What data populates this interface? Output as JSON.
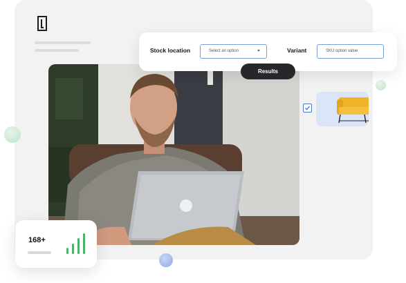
{
  "logo": {
    "icon": "brand-logo-icon"
  },
  "filters": {
    "stock_location_label": "Stock location",
    "stock_location_value": "Select an option",
    "variant_label": "Variant",
    "variant_value": "SKU option value"
  },
  "results_label": "Results",
  "product_selected": true,
  "stat": {
    "value": "168+",
    "bar_levels": [
      0.3,
      0.5,
      0.75,
      1.0
    ]
  },
  "colors": {
    "accent_dark": "#26272b",
    "input_border": "#7a9fd8",
    "bar_green": "#4caf6a",
    "tile_blue": "#dbe5f8",
    "sofa_yellow": "#f0b429"
  }
}
